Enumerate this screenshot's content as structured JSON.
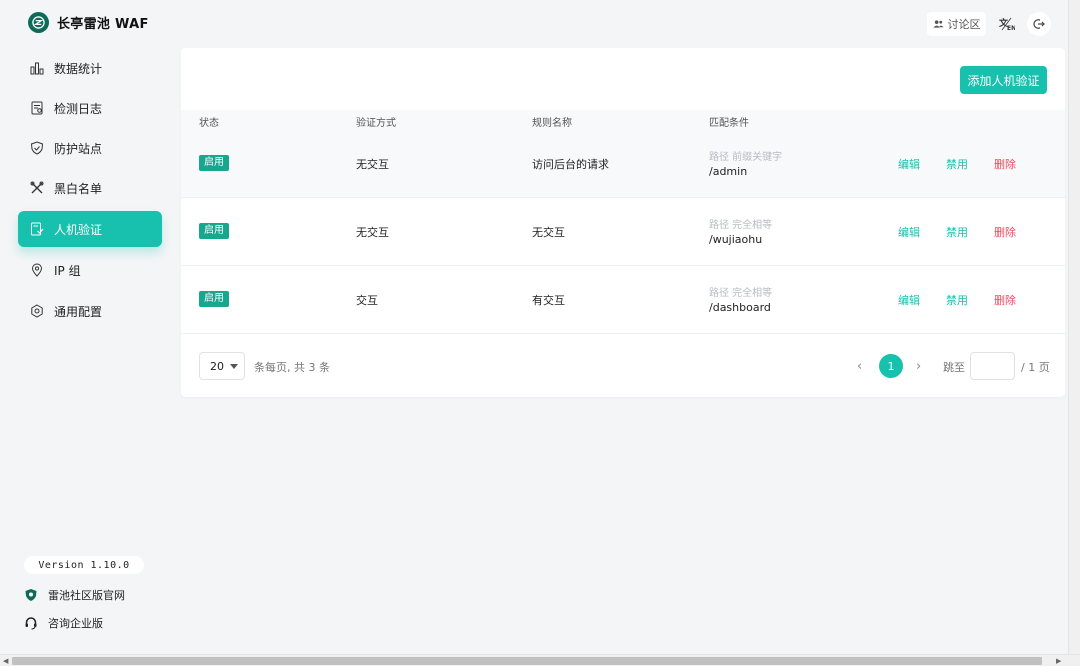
{
  "app": {
    "brand": "长亭雷池 WAF",
    "forum_label": "讨论区",
    "lang_icon": "translate-icon",
    "logout_icon": "logout-icon"
  },
  "sidebar": {
    "items": [
      {
        "label": "数据统计",
        "icon": "bar-chart-icon"
      },
      {
        "label": "检测日志",
        "icon": "log-icon"
      },
      {
        "label": "防护站点",
        "icon": "shield-icon"
      },
      {
        "label": "黑白名单",
        "icon": "tools-icon"
      },
      {
        "label": "人机验证",
        "icon": "captcha-icon",
        "active": true
      },
      {
        "label": "IP 组",
        "icon": "location-icon"
      },
      {
        "label": "通用配置",
        "icon": "gear-icon"
      }
    ],
    "version": "Version 1.10.0",
    "community_link": "雷池社区版官网",
    "enterprise_link": "咨询企业版"
  },
  "main": {
    "add_button": "添加人机验证",
    "columns": [
      "状态",
      "验证方式",
      "规则名称",
      "匹配条件"
    ],
    "rows": [
      {
        "status": "启用",
        "method": "无交互",
        "name": "访问后台的请求",
        "cond_type": "路径 前缀关键字",
        "cond_value": "/admin",
        "edit": "编辑",
        "disable": "禁用",
        "delete": "删除"
      },
      {
        "status": "启用",
        "method": "无交互",
        "name": "无交互",
        "cond_type": "路径 完全相等",
        "cond_value": "/wujiaohu",
        "edit": "编辑",
        "disable": "禁用",
        "delete": "删除"
      },
      {
        "status": "启用",
        "method": "交互",
        "name": "有交互",
        "cond_type": "路径 完全相等",
        "cond_value": "/dashboard",
        "edit": "编辑",
        "disable": "禁用",
        "delete": "删除"
      }
    ],
    "pagination": {
      "page_size": "20",
      "summary": "条每页, 共 3 条",
      "current_page": "1",
      "jump_label": "跳至",
      "total_pages": "/ 1 页"
    }
  },
  "colors": {
    "accent": "#17c1ae",
    "badge": "#17a68e",
    "danger": "#f0485f",
    "logo": "#0e6b5a"
  }
}
